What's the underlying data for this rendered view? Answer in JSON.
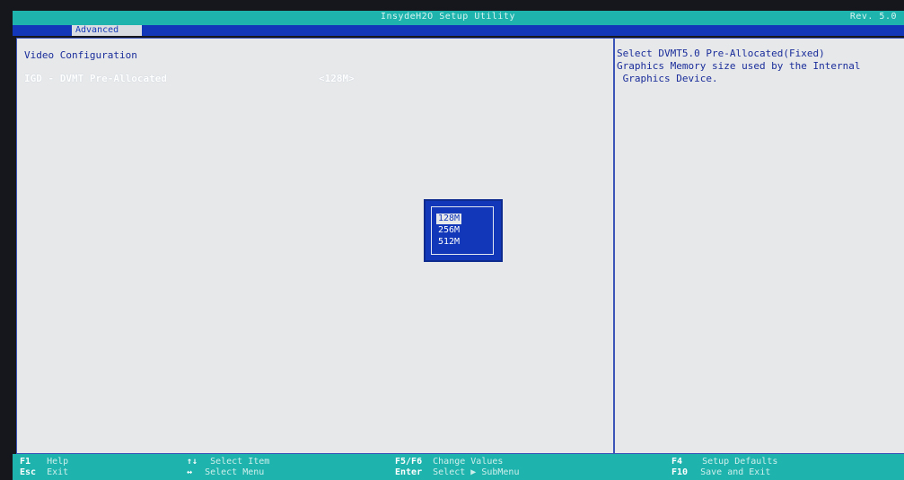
{
  "header": {
    "app_title": "InsydeH2O Setup Utility",
    "revision": "Rev. 5.0",
    "active_tab": "Advanced"
  },
  "main": {
    "section_title": "Video Configuration",
    "setting": {
      "label": "IGD - DVMT Pre-Allocated",
      "value": "<128M>"
    }
  },
  "help": {
    "text": "Select DVMT5.0 Pre-Allocated(Fixed)\nGraphics Memory size used by the Internal\n Graphics Device."
  },
  "popup": {
    "options": [
      "128M",
      "256M",
      "512M"
    ],
    "selected_index": 0
  },
  "footer": {
    "left": [
      {
        "key": "F1",
        "desc": "Help"
      },
      {
        "key": "Esc",
        "desc": "Exit"
      }
    ],
    "mid1": [
      {
        "key": "↑↓",
        "desc": "Select Item"
      },
      {
        "key": "↔",
        "desc": "Select Menu"
      }
    ],
    "mid2": [
      {
        "key": "F5/F6",
        "desc": "Change Values"
      },
      {
        "key": "Enter",
        "desc": "Select ▶ SubMenu"
      }
    ],
    "right": [
      {
        "key": "F4",
        "desc": "Setup Defaults"
      },
      {
        "key": "F10",
        "desc": "Save and Exit"
      }
    ]
  },
  "colors": {
    "accent_teal": "#1fb3ad",
    "bios_blue": "#1237b8",
    "panel_bg": "#e6e8ea"
  }
}
